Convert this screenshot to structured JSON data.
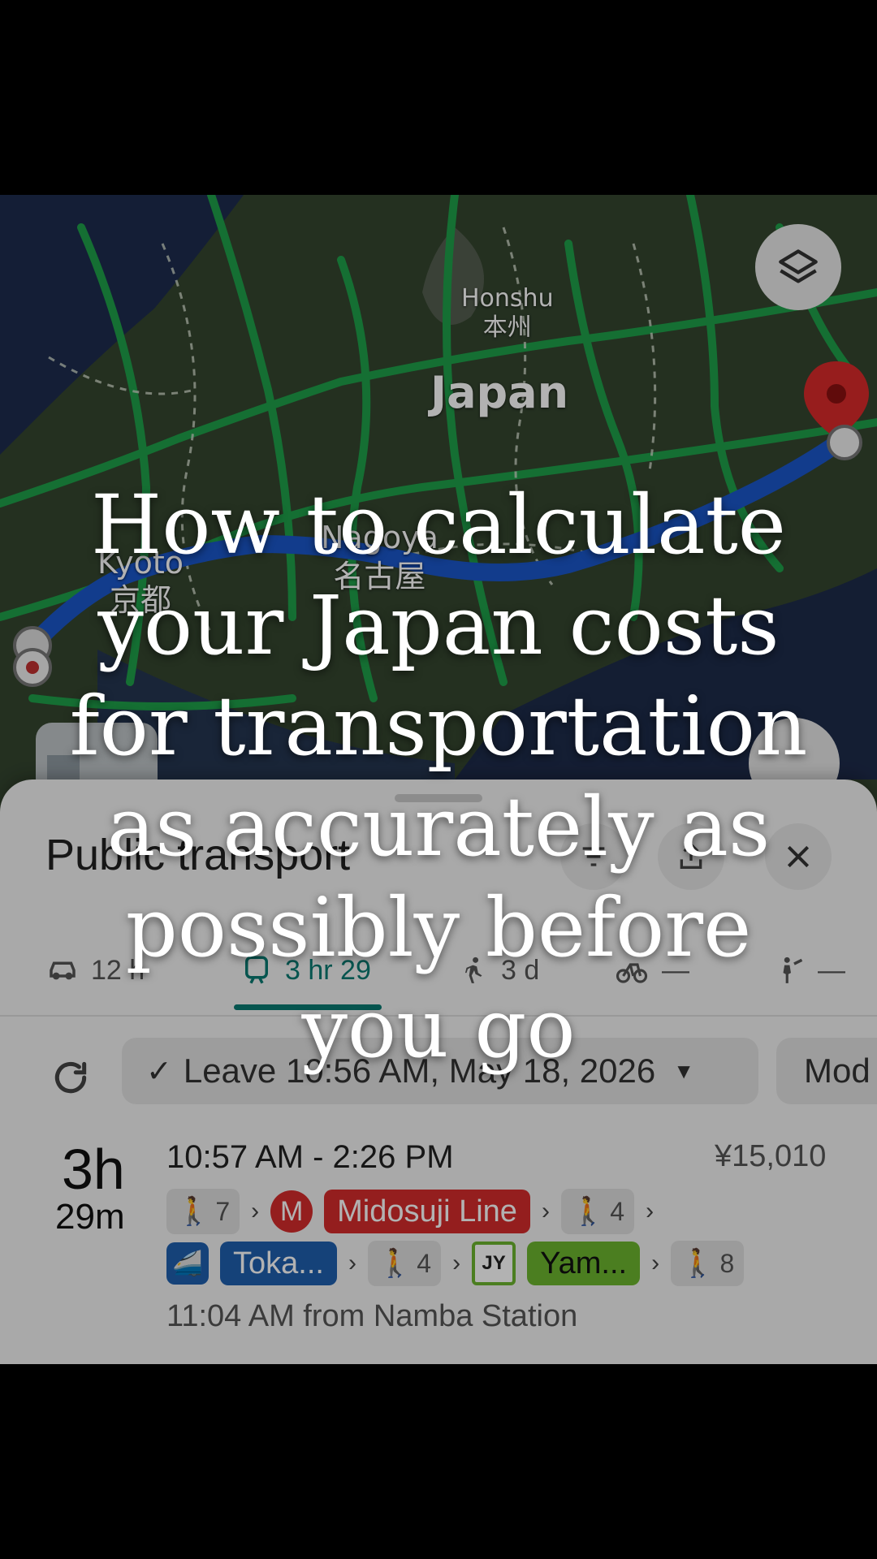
{
  "map": {
    "label_honshu": "Honshu",
    "label_honshu_ja": "本州",
    "label_japan": "Japan",
    "label_kyoto": "Kyoto",
    "label_kyoto_ja": "京都",
    "label_nagoya": "Nagoya",
    "label_nagoya_ja": "名古屋",
    "layers_icon": "layers-icon",
    "destination_icon": "map-pin-icon"
  },
  "sheet": {
    "title": "Public transport",
    "icons": [
      "filter-icon",
      "share-icon",
      "close-icon"
    ],
    "modes": [
      {
        "icon": "car-icon",
        "label": "12 h"
      },
      {
        "icon": "transit-icon",
        "label": "3 hr 29"
      },
      {
        "icon": "walk-icon",
        "label": "3 d"
      },
      {
        "icon": "bike-icon",
        "label": "—"
      },
      {
        "icon": "ride-hail-icon",
        "label": "—"
      }
    ],
    "leave_label": "Leave 10:56 AM, May 18, 2026",
    "more_label": "Mod",
    "route": {
      "duration_hours": "3h",
      "duration_minutes": "29m",
      "time_span": "10:57 AM - 2:26 PM",
      "fare": "¥15,010",
      "walk_1": "7",
      "metro_badge": "M",
      "line_1": "Midosuji Line",
      "walk_2": "4",
      "line_2": "Toka...",
      "walk_3": "4",
      "jr_badge": "JY",
      "line_3": "Yam...",
      "walk_4": "8",
      "departure": "11:04 AM from Namba Station"
    }
  },
  "overlay": {
    "headline": "How to calculate your Japan costs for transportation as accurately as possibly before you go"
  },
  "colors": {
    "midosuji": "#d52b2b",
    "tokaido": "#1f5fae",
    "yamanote": "#6cb52f",
    "route_blue": "#1a56c9",
    "road_green": "#22a045"
  }
}
